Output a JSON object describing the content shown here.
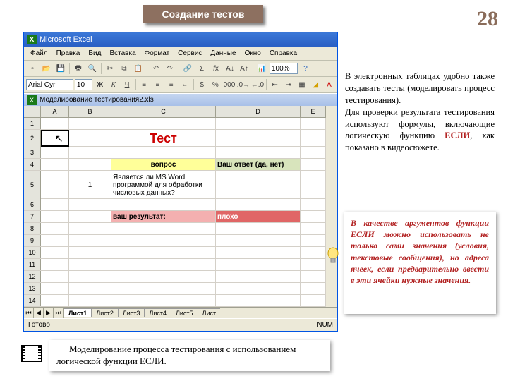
{
  "slide": {
    "title": "Создание тестов",
    "page_number": "28"
  },
  "excel": {
    "app_name": "Microsoft Excel",
    "menus": [
      "Файл",
      "Правка",
      "Вид",
      "Вставка",
      "Формат",
      "Сервис",
      "Данные",
      "Окно",
      "Справка"
    ],
    "font_name": "Arial Cyr",
    "font_size": "10",
    "zoom": "100%",
    "workbook_title": "Моделирование тестирования2.xls",
    "columns": [
      "A",
      "B",
      "C",
      "D",
      "E"
    ],
    "rows": [
      "1",
      "2",
      "3",
      "4",
      "5",
      "6",
      "7",
      "8",
      "9",
      "10",
      "11",
      "12",
      "13",
      "14"
    ],
    "cells": {
      "C2": "Тест",
      "C4": "вопрос",
      "D4": "Ваш ответ (да, нет)",
      "B5": "1",
      "C5": "Является ли MS Word программой для обработки числовых данных?",
      "C7": "ваш результат:",
      "D7": "плохо"
    },
    "sheet_tabs": [
      "Лист1",
      "Лист2",
      "Лист3",
      "Лист4",
      "Лист5",
      "Лист"
    ],
    "status": {
      "ready": "Готово",
      "num": "NUM"
    }
  },
  "body_text": {
    "p1a": "В электронных таблицах удобно также создавать тесты (моделировать процесс тестирования).",
    "p2a": "Для проверки результата тестирования используют формулы, включающие логическую функцию ",
    "p2b": "ЕСЛИ",
    "p2c": ", как показано в видеосюжете."
  },
  "tip_text": "В качестве аргументов функции ЕСЛИ можно использовать не только сами значения (условия, текстовые сообщения), но адреса ячеек, если предварительно ввести в эти ячейки нужные значения.",
  "caption": "Моделирование процесса тестирования с использованием логической функции ЕСЛИ.",
  "colors": {
    "yellow": "#ffff99",
    "green": "#d8e4bc",
    "pink": "#f4b0b0",
    "red": "#e06666"
  }
}
